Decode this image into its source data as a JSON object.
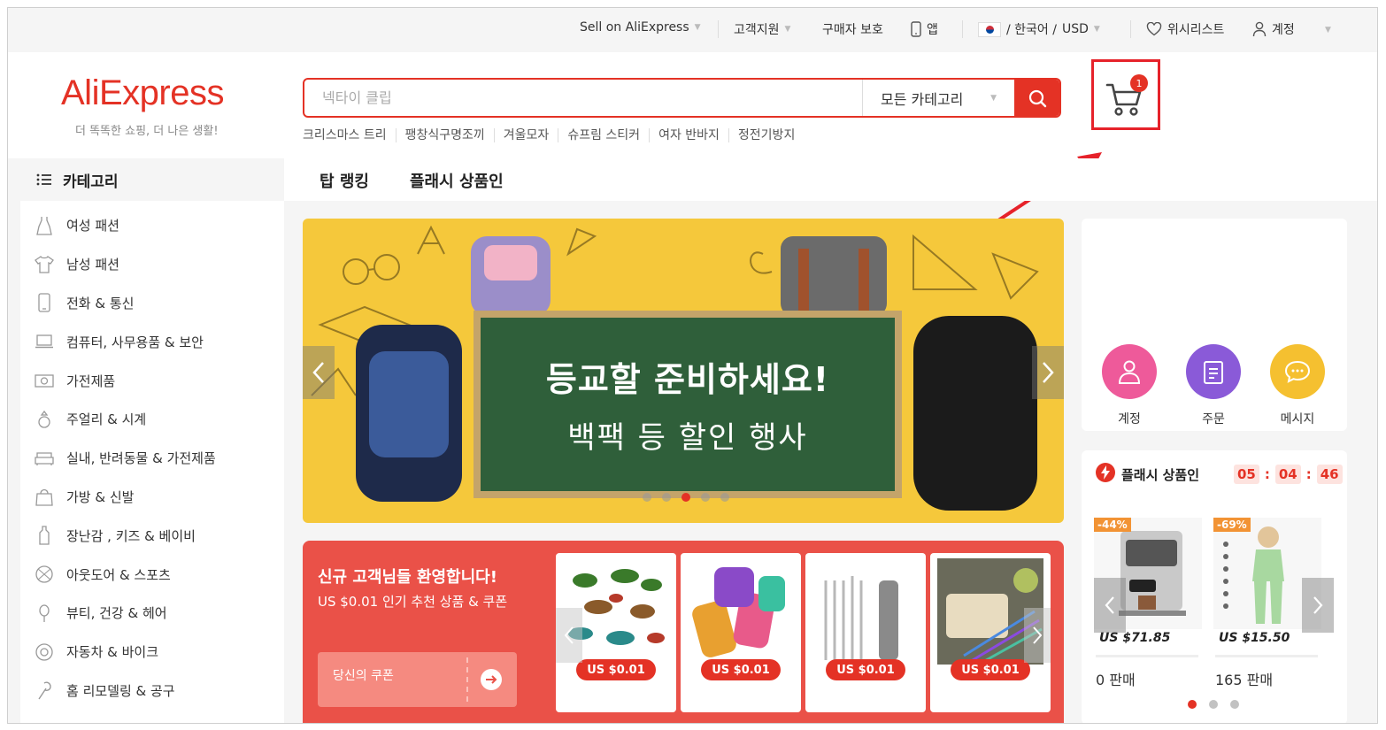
{
  "topbar": {
    "sell": "Sell on AliExpress",
    "support": "고객지원",
    "buyer_protection": "구매자 보호",
    "app": "앱",
    "language": "/ 한국어 /",
    "currency": "USD",
    "wishlist": "위시리스트",
    "account": "계정"
  },
  "header": {
    "logo": "AliExpress",
    "tagline": "더 똑똑한 쇼핑, 더 나은 생활!",
    "search_placeholder": "넥타이 클립",
    "category_select": "모든 카테고리",
    "hot_words": [
      "크리스마스 트리",
      "팽창식구명조끼",
      "겨울모자",
      "슈프림 스티커",
      "여자 반바지",
      "정전기방지"
    ],
    "cart_count": "1"
  },
  "categories": {
    "title": "카테고리",
    "items": [
      {
        "label": "여성 패션",
        "icon": "dress-icon"
      },
      {
        "label": "남성 패션",
        "icon": "shirt-icon"
      },
      {
        "label": "전화 & 통신",
        "icon": "phone-icon"
      },
      {
        "label": "컴퓨터, 사무용품 & 보안",
        "icon": "laptop-icon"
      },
      {
        "label": "가전제품",
        "icon": "camera-icon"
      },
      {
        "label": "주얼리 & 시계",
        "icon": "ring-icon"
      },
      {
        "label": "실내, 반려동물 & 가전제품",
        "icon": "sofa-icon"
      },
      {
        "label": "가방 & 신발",
        "icon": "bag-icon"
      },
      {
        "label": "장난감 , 키즈 & 베이비",
        "icon": "bottle-icon"
      },
      {
        "label": "아웃도어 & 스포츠",
        "icon": "ball-icon"
      },
      {
        "label": "뷰티, 건강 & 헤어",
        "icon": "beauty-icon"
      },
      {
        "label": "자동차 & 바이크",
        "icon": "wheel-icon"
      },
      {
        "label": "홈 리모델링 & 공구",
        "icon": "tool-icon"
      }
    ]
  },
  "nav": {
    "top_ranking": "탑 랭킹",
    "flash_deals": "플래시 상품인"
  },
  "banner": {
    "title": "등교할 준비하세요!",
    "subtitle": "백팩 등 할인 행사",
    "active_slide": 3,
    "slide_count": 5
  },
  "newuser": {
    "title": "신규 고객님들 환영합니다!",
    "subtitle": "US $0.01 인기 추천 상품 & 쿠폰",
    "coupon_label": "당신의 쿠폰",
    "products": [
      {
        "price": "US $0.01"
      },
      {
        "price": "US $0.01"
      },
      {
        "price": "US $0.01"
      },
      {
        "price": "US $0.01"
      }
    ]
  },
  "user_panel": {
    "account": "계정",
    "orders": "주문",
    "messages": "메시지"
  },
  "flash": {
    "title": "플래시 상품인",
    "timer": {
      "h": "05",
      "m": "04",
      "s": "46"
    },
    "items": [
      {
        "discount": "-44%",
        "price": "US $71.85",
        "sold": "0 판매"
      },
      {
        "discount": "-69%",
        "price": "US $15.50",
        "sold": "165 판매"
      }
    ]
  },
  "colors": {
    "brand": "#e43225",
    "annotation": "#e6222a"
  }
}
